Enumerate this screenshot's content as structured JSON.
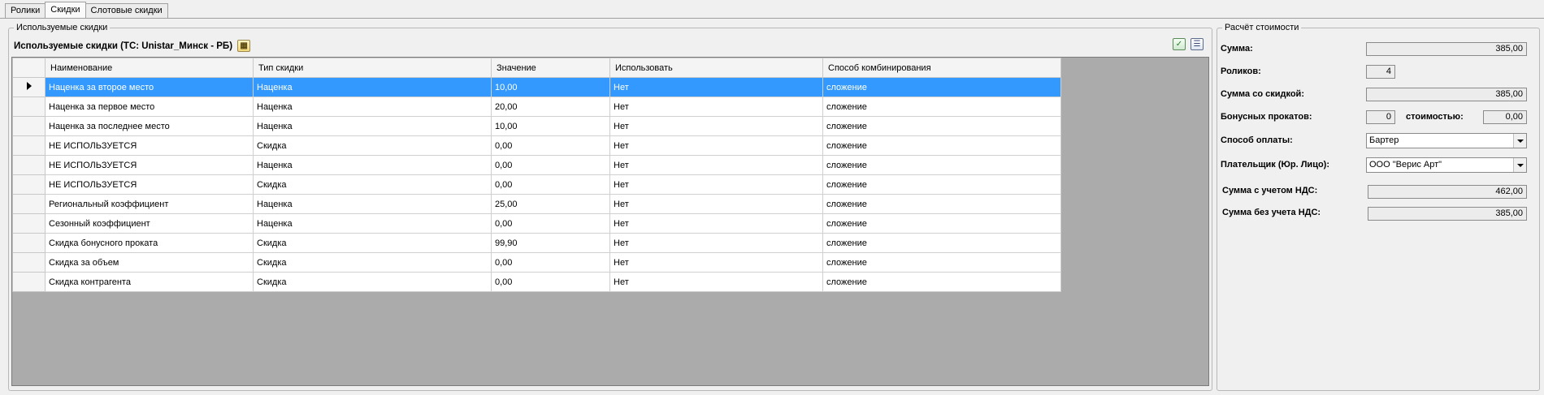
{
  "tabs": [
    {
      "label": "Ролики"
    },
    {
      "label": "Скидки"
    },
    {
      "label": "Слотовые скидки"
    }
  ],
  "discounts_panel": {
    "legend": "Используемые скидки",
    "header": "Используемые скидки (ТС: Unistar_Минск - РБ)",
    "toolbar_icons": [
      "check-list-icon",
      "columns-icon"
    ],
    "columns": [
      "Наименование",
      "Тип скидки",
      "Значение",
      "Использовать",
      "Способ комбинирования"
    ],
    "selected_row": 0,
    "rows": [
      {
        "name": "Наценка за второе место",
        "type": "Наценка",
        "value": "10,00",
        "use": "Нет",
        "combine": "сложение"
      },
      {
        "name": "Наценка за первое место",
        "type": "Наценка",
        "value": "20,00",
        "use": "Нет",
        "combine": "сложение"
      },
      {
        "name": "Наценка за последнее место",
        "type": "Наценка",
        "value": "10,00",
        "use": "Нет",
        "combine": "сложение"
      },
      {
        "name": "НЕ ИСПОЛЬЗУЕТСЯ",
        "type": "Скидка",
        "value": "0,00",
        "use": "Нет",
        "combine": "сложение"
      },
      {
        "name": "НЕ ИСПОЛЬЗУЕТСЯ",
        "type": "Наценка",
        "value": "0,00",
        "use": "Нет",
        "combine": "сложение"
      },
      {
        "name": "НЕ ИСПОЛЬЗУЕТСЯ",
        "type": "Скидка",
        "value": "0,00",
        "use": "Нет",
        "combine": "сложение"
      },
      {
        "name": "Региональный коэффициент",
        "type": "Наценка",
        "value": "25,00",
        "use": "Нет",
        "combine": "сложение"
      },
      {
        "name": "Сезонный коэффициент",
        "type": "Наценка",
        "value": "0,00",
        "use": "Нет",
        "combine": "сложение"
      },
      {
        "name": "Скидка бонусного проката",
        "type": "Скидка",
        "value": "99,90",
        "use": "Нет",
        "combine": "сложение"
      },
      {
        "name": "Скидка за объем",
        "type": "Скидка",
        "value": "0,00",
        "use": "Нет",
        "combine": "сложение"
      },
      {
        "name": "Скидка контрагента",
        "type": "Скидка",
        "value": "0,00",
        "use": "Нет",
        "combine": "сложение"
      }
    ]
  },
  "cost_panel": {
    "legend": "Расчёт стоимости",
    "sum_label": "Сумма:",
    "sum_value": "385,00",
    "rolls_label": "Роликов:",
    "rolls_value": "4",
    "discount_sum_label": "Сумма со скидкой:",
    "discount_sum_value": "385,00",
    "bonus_label": "Бонусных прокатов:",
    "bonus_value": "0",
    "cost_label": "стоимостью:",
    "cost_value": "0,00",
    "payment_label": "Способ оплаты:",
    "payment_value": "Бартер",
    "payer_label": "Плательщик (Юр. Лицо):",
    "payer_value": "ООО \"Верис Арт\"",
    "vat_sum_label": "Сумма с учетом НДС:",
    "vat_sum_value": "462,00",
    "novat_sum_label": "Сумма без учета НДС:",
    "novat_sum_value": "385,00"
  }
}
